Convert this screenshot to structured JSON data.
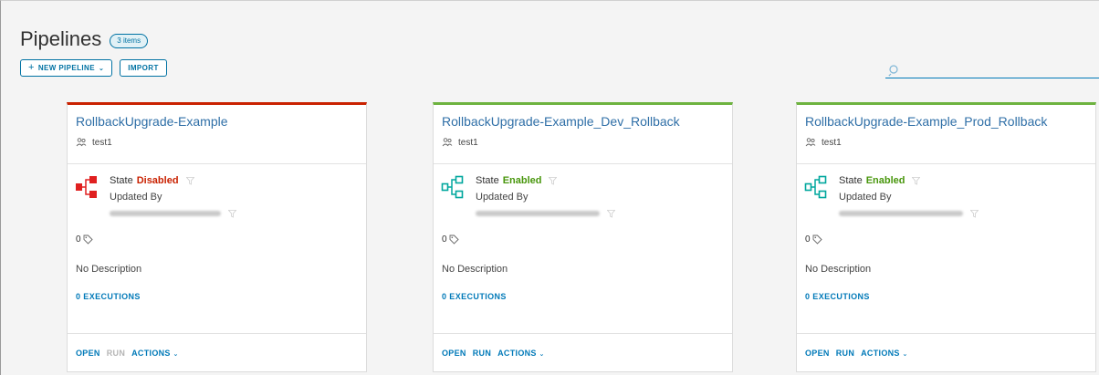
{
  "header": {
    "title": "Pipelines",
    "count_badge": "3 items",
    "new_pipeline_label": "NEW PIPELINE",
    "new_pipeline_plus": "+",
    "import_label": "IMPORT"
  },
  "search": {
    "placeholder": "",
    "value": ""
  },
  "colors": {
    "enabled": "#48960c",
    "disabled": "#c92100",
    "accent": "#0079b8",
    "link": "#2f6fa7"
  },
  "cards": [
    {
      "name": "RollbackUpgrade-Example",
      "project": "test1",
      "state_label": "State",
      "state_value": "Disabled",
      "updated_by_label": "Updated By",
      "tag_count": "0",
      "description": "No Description",
      "executions": "0 EXECUTIONS",
      "open": "OPEN",
      "run": "RUN",
      "actions": "ACTIONS",
      "icon": "pipeline-disabled-icon"
    },
    {
      "name": "RollbackUpgrade-Example_Dev_Rollback",
      "project": "test1",
      "state_label": "State",
      "state_value": "Enabled",
      "updated_by_label": "Updated By",
      "tag_count": "0",
      "description": "No Description",
      "executions": "0 EXECUTIONS",
      "open": "OPEN",
      "run": "RUN",
      "actions": "ACTIONS",
      "icon": "pipeline-enabled-icon"
    },
    {
      "name": "RollbackUpgrade-Example_Prod_Rollback",
      "project": "test1",
      "state_label": "State",
      "state_value": "Enabled",
      "updated_by_label": "Updated By",
      "tag_count": "0",
      "description": "No Description",
      "executions": "0 EXECUTIONS",
      "open": "OPEN",
      "run": "RUN",
      "actions": "ACTIONS",
      "icon": "pipeline-enabled-icon"
    }
  ]
}
